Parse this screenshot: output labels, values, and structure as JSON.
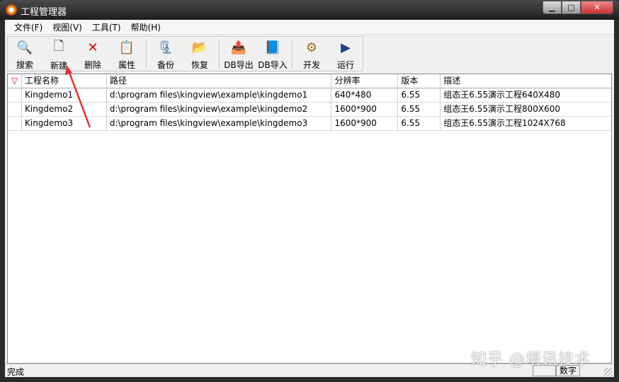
{
  "window": {
    "title": "工程管理器",
    "minimize": "▁",
    "maximize": "□",
    "close": "✕"
  },
  "menu": [
    "文件(F)",
    "视图(V)",
    "工具(T)",
    "帮助(H)"
  ],
  "toolbar": [
    {
      "label": "搜索",
      "icon": "search-icon",
      "glyph": "🔍"
    },
    {
      "label": "新建",
      "icon": "new-file-icon",
      "glyph": "🗋"
    },
    {
      "label": "删除",
      "icon": "delete-icon",
      "glyph": "✕"
    },
    {
      "label": "属性",
      "icon": "properties-icon",
      "glyph": "📋"
    },
    {
      "label": "备份",
      "icon": "backup-icon",
      "glyph": "🗜"
    },
    {
      "label": "恢复",
      "icon": "restore-icon",
      "glyph": "📂"
    },
    {
      "label": "DB导出",
      "icon": "db-export-icon",
      "glyph": "📤"
    },
    {
      "label": "DB导入",
      "icon": "db-import-icon",
      "glyph": "📘"
    },
    {
      "label": "开发",
      "icon": "develop-icon",
      "glyph": "⚙"
    },
    {
      "label": "运行",
      "icon": "run-icon",
      "glyph": "▶"
    }
  ],
  "table": {
    "flag": "▽",
    "headers": [
      "工程名称",
      "路径",
      "分辨率",
      "版本",
      "描述"
    ],
    "rows": [
      [
        "Kingdemo1",
        "d:\\program files\\kingview\\example\\kingdemo1",
        "640*480",
        "6.55",
        "组态王6.55演示工程640X480"
      ],
      [
        "Kingdemo2",
        "d:\\program files\\kingview\\example\\kingdemo2",
        "1600*900",
        "6.55",
        "组态王6.55演示工程800X600"
      ],
      [
        "Kingdemo3",
        "d:\\program files\\kingview\\example\\kingdemo3",
        "1600*900",
        "6.55",
        "组态王6.55演示工程1024X768"
      ]
    ]
  },
  "status": {
    "text": "完成",
    "num": "数字"
  },
  "watermark": "知乎 @塔讯技术"
}
